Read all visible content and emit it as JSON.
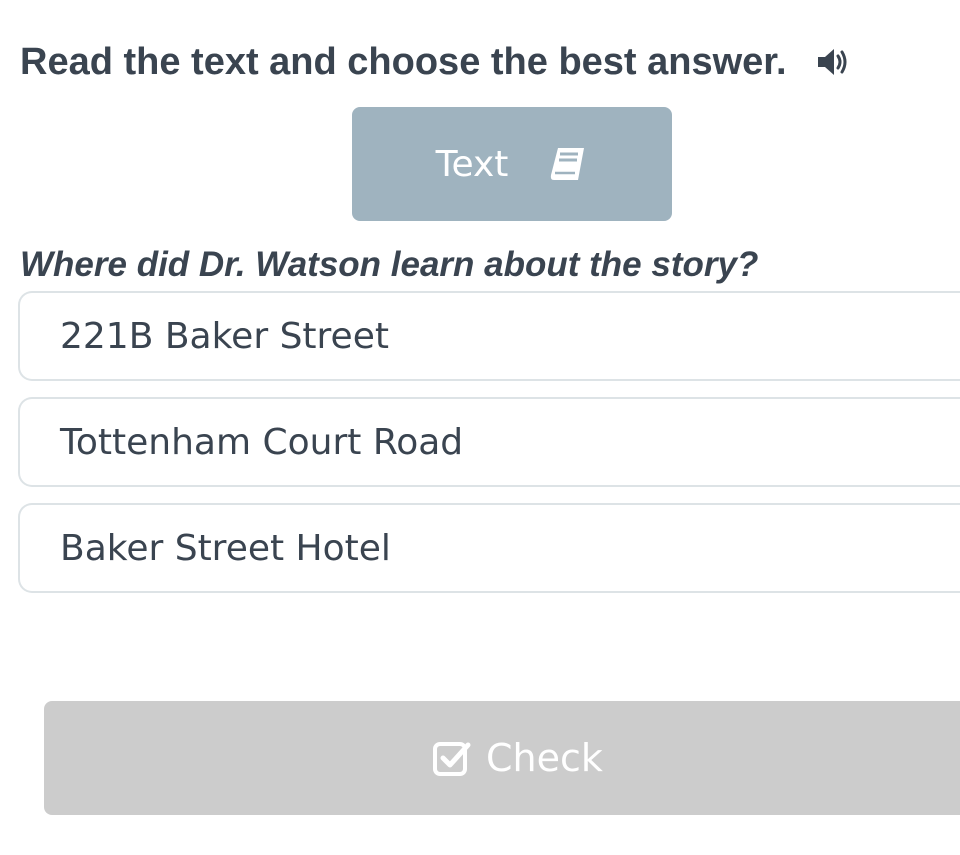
{
  "instruction": {
    "text": "Read the text and choose the best answer.",
    "audio_icon": "speaker-icon"
  },
  "text_button": {
    "label": "Text",
    "icon": "book-icon"
  },
  "question": {
    "text": "Where did Dr. Watson learn about the story?"
  },
  "options": [
    {
      "label": "221B Baker Street"
    },
    {
      "label": "Tottenham Court Road"
    },
    {
      "label": "Baker Street Hotel"
    }
  ],
  "check_button": {
    "label": "Check",
    "icon": "checkbox-icon"
  },
  "colors": {
    "text_primary": "#3a4450",
    "text_button_bg": "#9fb3bf",
    "option_border": "#dde3e6",
    "check_button_bg": "#cccccc",
    "button_text": "#ffffff"
  }
}
